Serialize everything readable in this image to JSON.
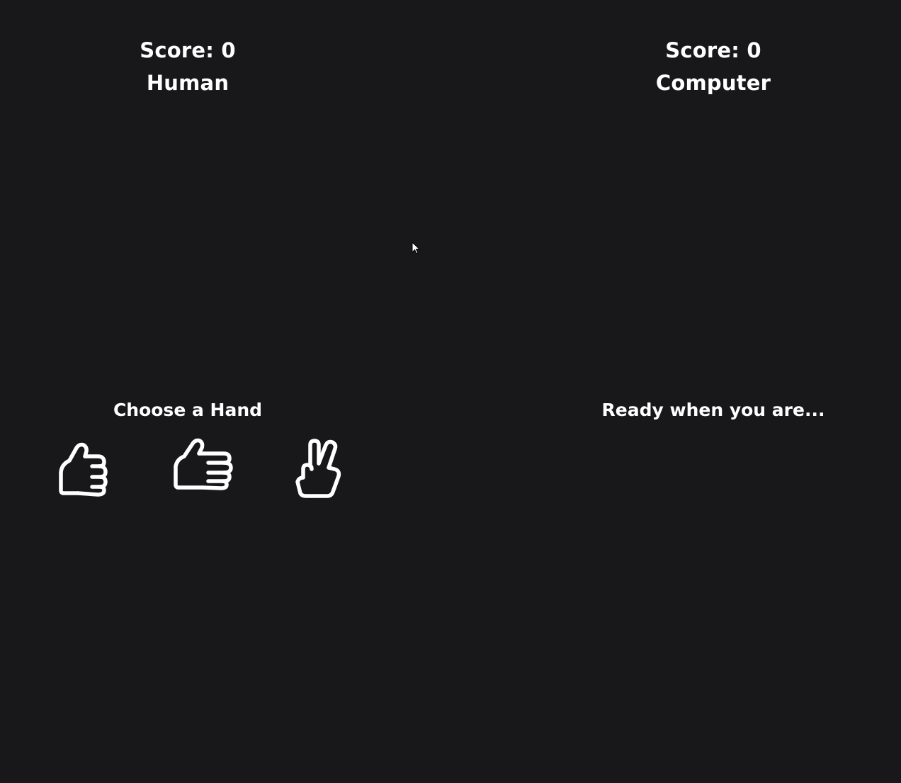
{
  "human": {
    "score_text": "Score: 0",
    "name": "Human",
    "prompt": "Choose a Hand"
  },
  "computer": {
    "score_text": "Score: 0",
    "name": "Computer",
    "prompt": "Ready when you are..."
  },
  "hands": [
    {
      "id": "rock",
      "icon": "fist-icon"
    },
    {
      "id": "paper",
      "icon": "open-hand-icon"
    },
    {
      "id": "scissors",
      "icon": "peace-hand-icon"
    }
  ],
  "colors": {
    "background": "#18181a",
    "foreground": "#ffffff"
  }
}
